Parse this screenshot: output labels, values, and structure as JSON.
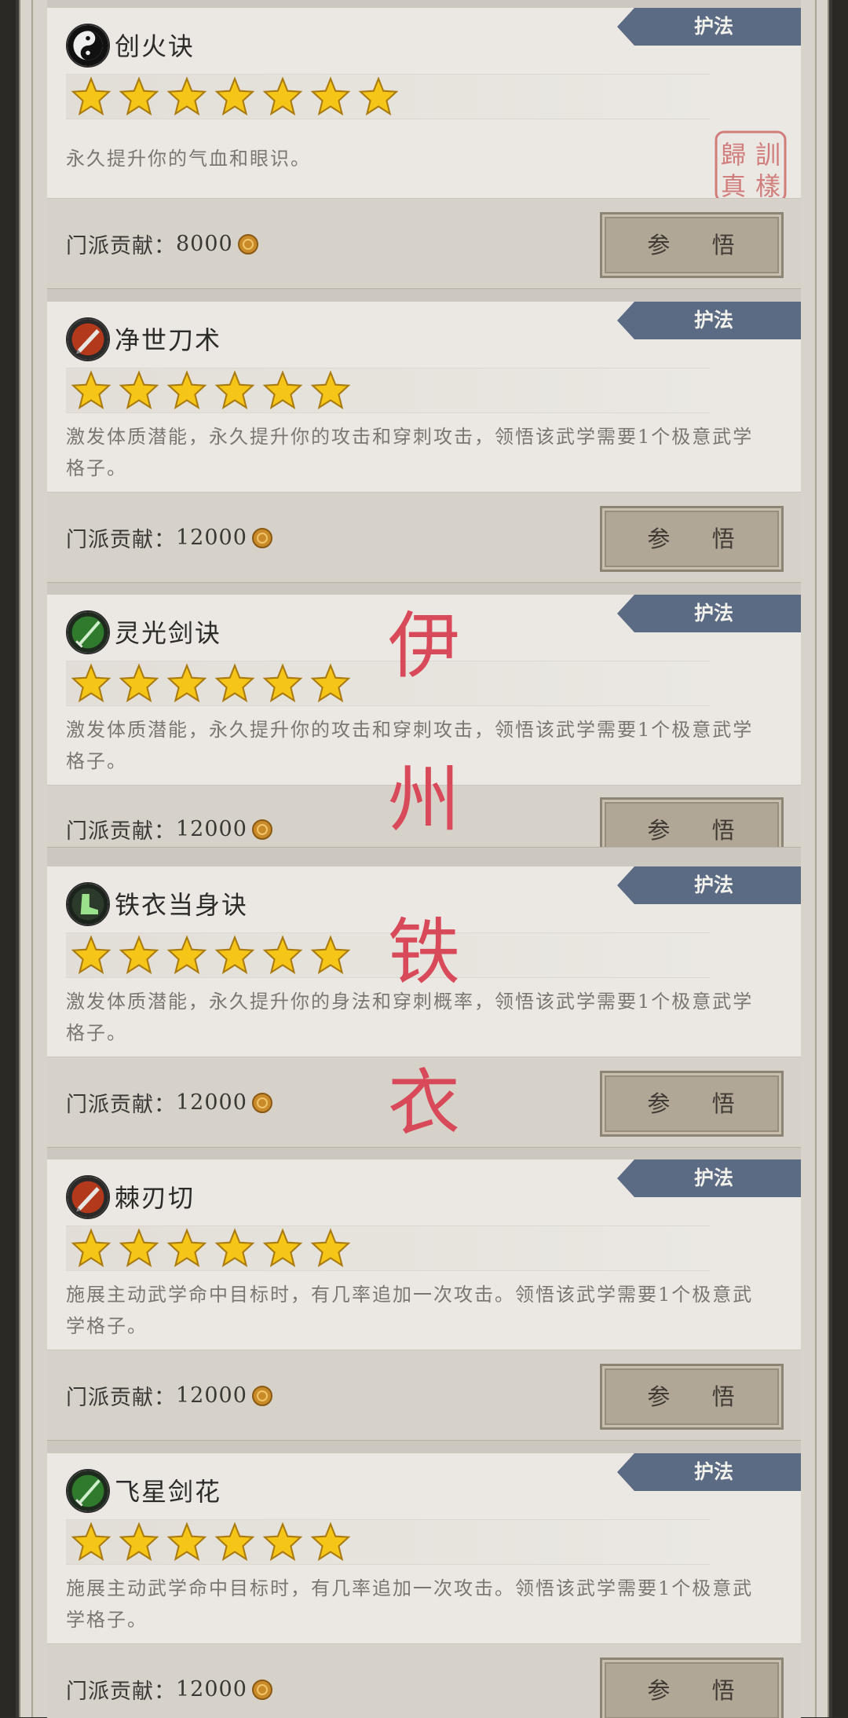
{
  "badge_label": "护法",
  "cost_prefix": "门派贡献：",
  "button_label": "参 悟",
  "skills": [
    {
      "name": "创火诀",
      "stars": 7,
      "icon": "yin-yang-icon",
      "description": "永久提升你的气血和眼识。",
      "cost": "8000"
    },
    {
      "name": "净世刀术",
      "stars": 6,
      "icon": "blade-icon",
      "description": "激发体质潜能，永久提升你的攻击和穿刺攻击，领悟该武学需要1个极意武学格子。",
      "cost": "12000"
    },
    {
      "name": "灵光剑诀",
      "stars": 6,
      "icon": "sword-icon",
      "description": "激发体质潜能，永久提升你的攻击和穿刺攻击，领悟该武学需要1个极意武学格子。",
      "cost": "12000"
    },
    {
      "name": "铁衣当身诀",
      "stars": 6,
      "icon": "boot-icon",
      "description": "激发体质潜能，永久提升你的身法和穿刺概率，领悟该武学需要1个极意武学格子。",
      "cost": "12000"
    },
    {
      "name": "棘刃切",
      "stars": 6,
      "icon": "blade-icon",
      "description": "施展主动武学命中目标时，有几率追加一次攻击。领悟该武学需要1个极意武学格子。",
      "cost": "12000"
    },
    {
      "name": "飞星剑花",
      "stars": 6,
      "icon": "sword-icon",
      "description": "施展主动武学命中目标时，有几率追加一次攻击。领悟该武学需要1个极意武学格子。",
      "cost": "12000"
    }
  ],
  "overlay_text": [
    "伊",
    "州",
    "铁",
    "衣"
  ],
  "seal_text": "訓樣歸真",
  "colors": {
    "badge": "#5a6b83",
    "overlay": "#d8495a",
    "star": "#f5c518"
  }
}
